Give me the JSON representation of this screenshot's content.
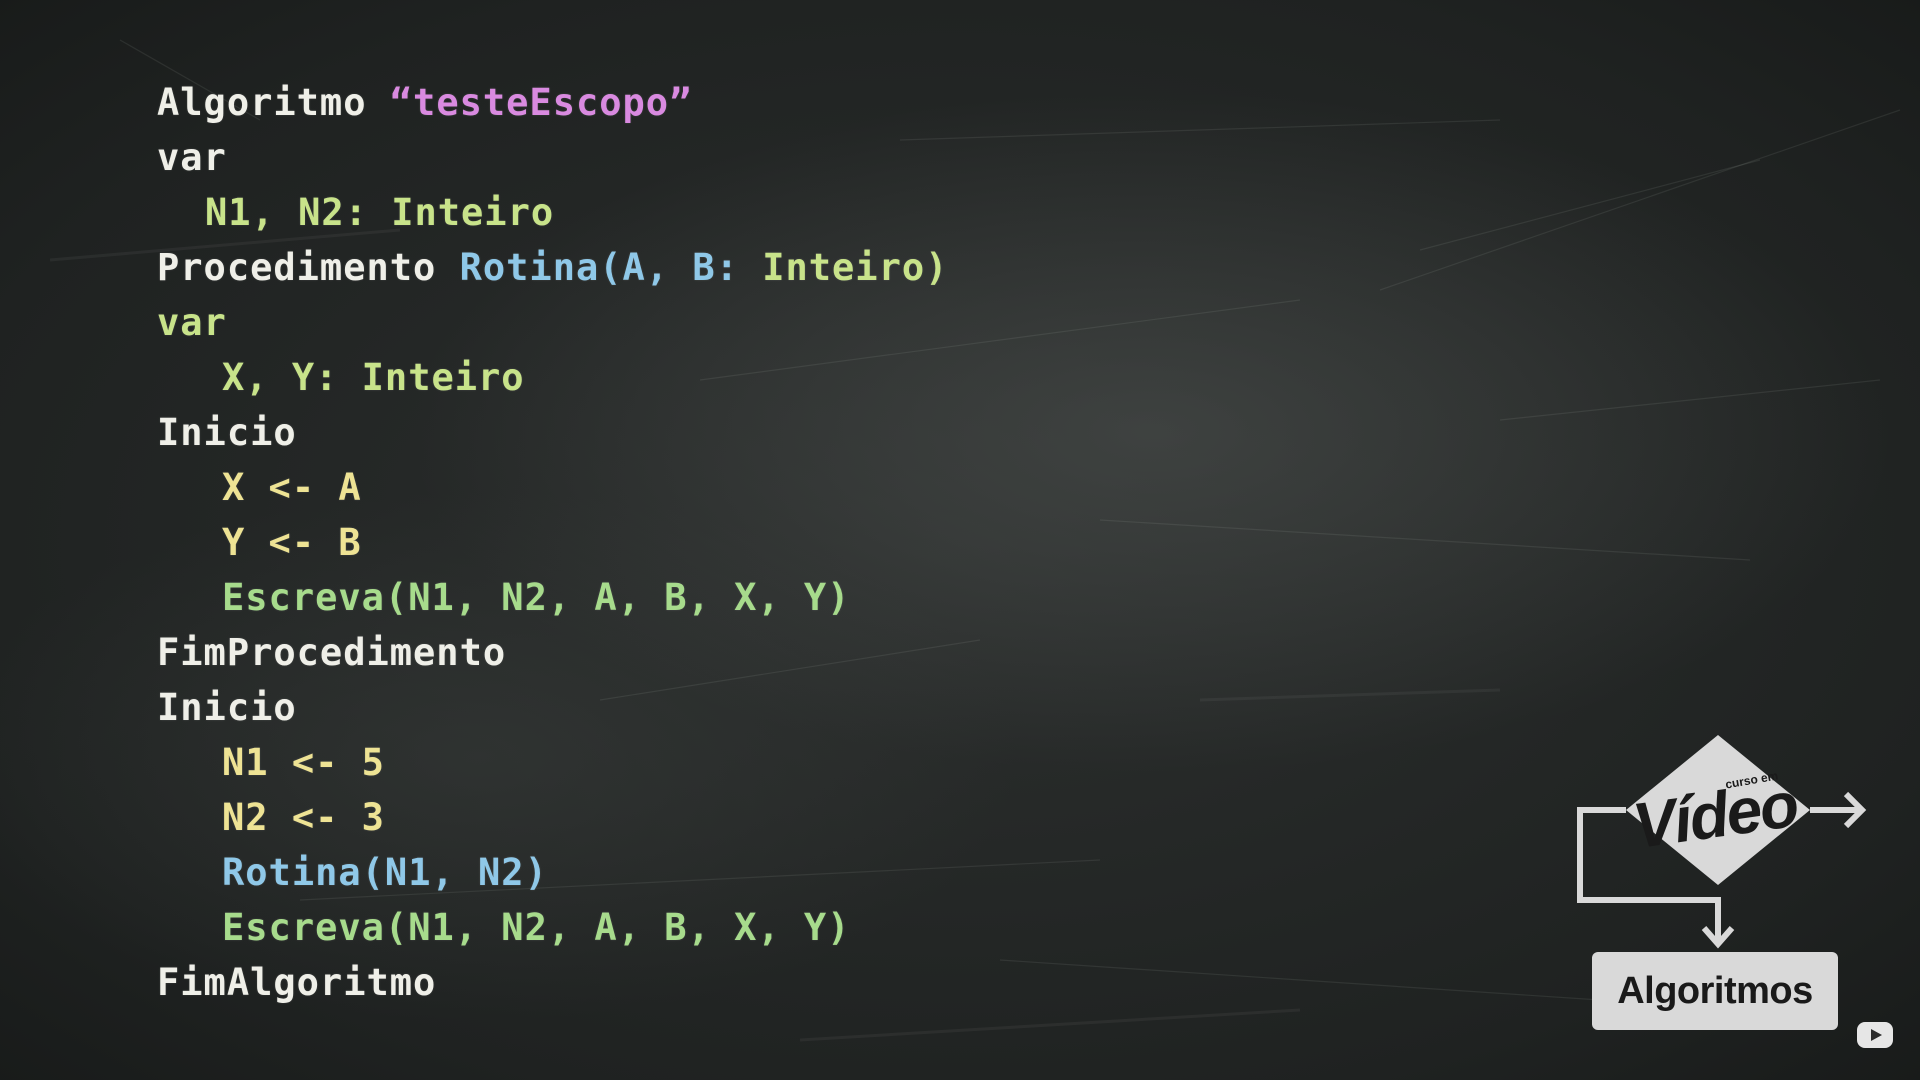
{
  "code_lines": [
    {
      "parts": [
        "Algoritmo ",
        "“testeEscopo”"
      ]
    },
    {
      "parts": [
        "var"
      ]
    },
    {
      "parts": [
        "N1, N2: Inteiro"
      ]
    },
    {
      "parts": [
        "Procedimento ",
        "Rotina(A, B: ",
        "Inteiro)"
      ]
    },
    {
      "parts": [
        "var"
      ]
    },
    {
      "parts": [
        "X, Y: Inteiro"
      ]
    },
    {
      "parts": [
        "Inicio"
      ]
    },
    {
      "parts": [
        "X <- A"
      ]
    },
    {
      "parts": [
        "Y <- B"
      ]
    },
    {
      "parts": [
        "Escreva(N1, N2, A, B, X, Y)"
      ]
    },
    {
      "parts": [
        "FimProcedimento"
      ]
    },
    {
      "parts": [
        "Inicio"
      ]
    },
    {
      "parts": [
        "N1 <- 5"
      ]
    },
    {
      "parts": [
        "N2 <- 3"
      ]
    },
    {
      "parts": [
        "Rotina(N1, N2)"
      ]
    },
    {
      "parts": [
        "Escreva(N1, N2, A, B, X, Y)"
      ]
    },
    {
      "parts": [
        "FimAlgoritmo"
      ]
    }
  ],
  "logo": {
    "small_text": "curso em",
    "video_text": "Vídeo",
    "label": "Algoritmos"
  },
  "colors": {
    "background": "#1e2020",
    "keyword": "#efefe8",
    "string": "#d98ae0",
    "declaration": "#c8e38a",
    "assignment": "#eee394",
    "procedure_call": "#8fc8e8",
    "output_call": "#a7db8c"
  },
  "icons": [
    "video-play-icon"
  ]
}
